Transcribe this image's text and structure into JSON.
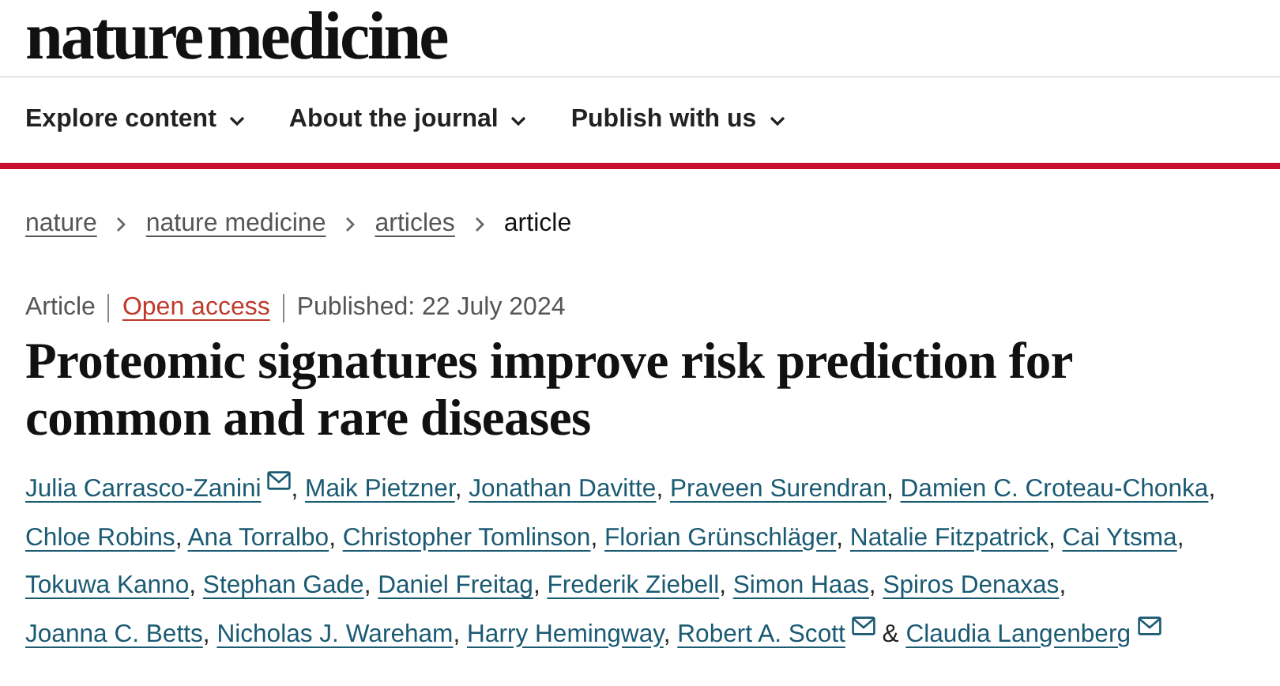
{
  "site": {
    "logo": "nature medicine"
  },
  "nav": [
    {
      "label": "Explore content"
    },
    {
      "label": "About the journal"
    },
    {
      "label": "Publish with us"
    }
  ],
  "breadcrumbs": [
    {
      "label": "nature",
      "kind": "link"
    },
    {
      "label": "nature medicine",
      "kind": "link"
    },
    {
      "label": "articles",
      "kind": "link"
    },
    {
      "label": "article",
      "kind": "current"
    }
  ],
  "article": {
    "meta": [
      {
        "label": "Article",
        "kind": "text"
      },
      {
        "label": "Open access",
        "kind": "link"
      },
      {
        "label": "Published: 22 July 2024",
        "kind": "text"
      }
    ],
    "title": "Proteomic signatures improve risk prediction for common and rare diseases",
    "authors": [
      {
        "name": "Julia Carrasco-Zanini",
        "email": true,
        "separator": ","
      },
      {
        "name": "Maik Pietzner",
        "email": false,
        "separator": ","
      },
      {
        "name": "Jonathan Davitte",
        "email": false,
        "separator": ","
      },
      {
        "name": "Praveen Surendran",
        "email": false,
        "separator": ","
      },
      {
        "name": "Damien C. Croteau-Chonka",
        "email": false,
        "separator": ","
      },
      {
        "name": "Chloe Robins",
        "email": false,
        "separator": ","
      },
      {
        "name": "Ana Torralbo",
        "email": false,
        "separator": ","
      },
      {
        "name": "Christopher Tomlinson",
        "email": false,
        "separator": ","
      },
      {
        "name": "Florian Grünschläger",
        "email": false,
        "separator": ","
      },
      {
        "name": "Natalie Fitzpatrick",
        "email": false,
        "separator": ","
      },
      {
        "name": "Cai Ytsma",
        "email": false,
        "separator": ","
      },
      {
        "name": "Tokuwa Kanno",
        "email": false,
        "separator": ","
      },
      {
        "name": "Stephan Gade",
        "email": false,
        "separator": ","
      },
      {
        "name": "Daniel Freitag",
        "email": false,
        "separator": ","
      },
      {
        "name": "Frederik Ziebell",
        "email": false,
        "separator": ","
      },
      {
        "name": "Simon Haas",
        "email": false,
        "separator": ","
      },
      {
        "name": "Spiros Denaxas",
        "email": false,
        "separator": ","
      },
      {
        "name": "Joanna C. Betts",
        "email": false,
        "separator": ","
      },
      {
        "name": "Nicholas J. Wareham",
        "email": false,
        "separator": ","
      },
      {
        "name": "Harry Hemingway",
        "email": false,
        "separator": ","
      },
      {
        "name": "Robert A. Scott",
        "email": true,
        "separator": "&"
      },
      {
        "name": "Claudia Langenberg",
        "email": true
      }
    ]
  }
}
